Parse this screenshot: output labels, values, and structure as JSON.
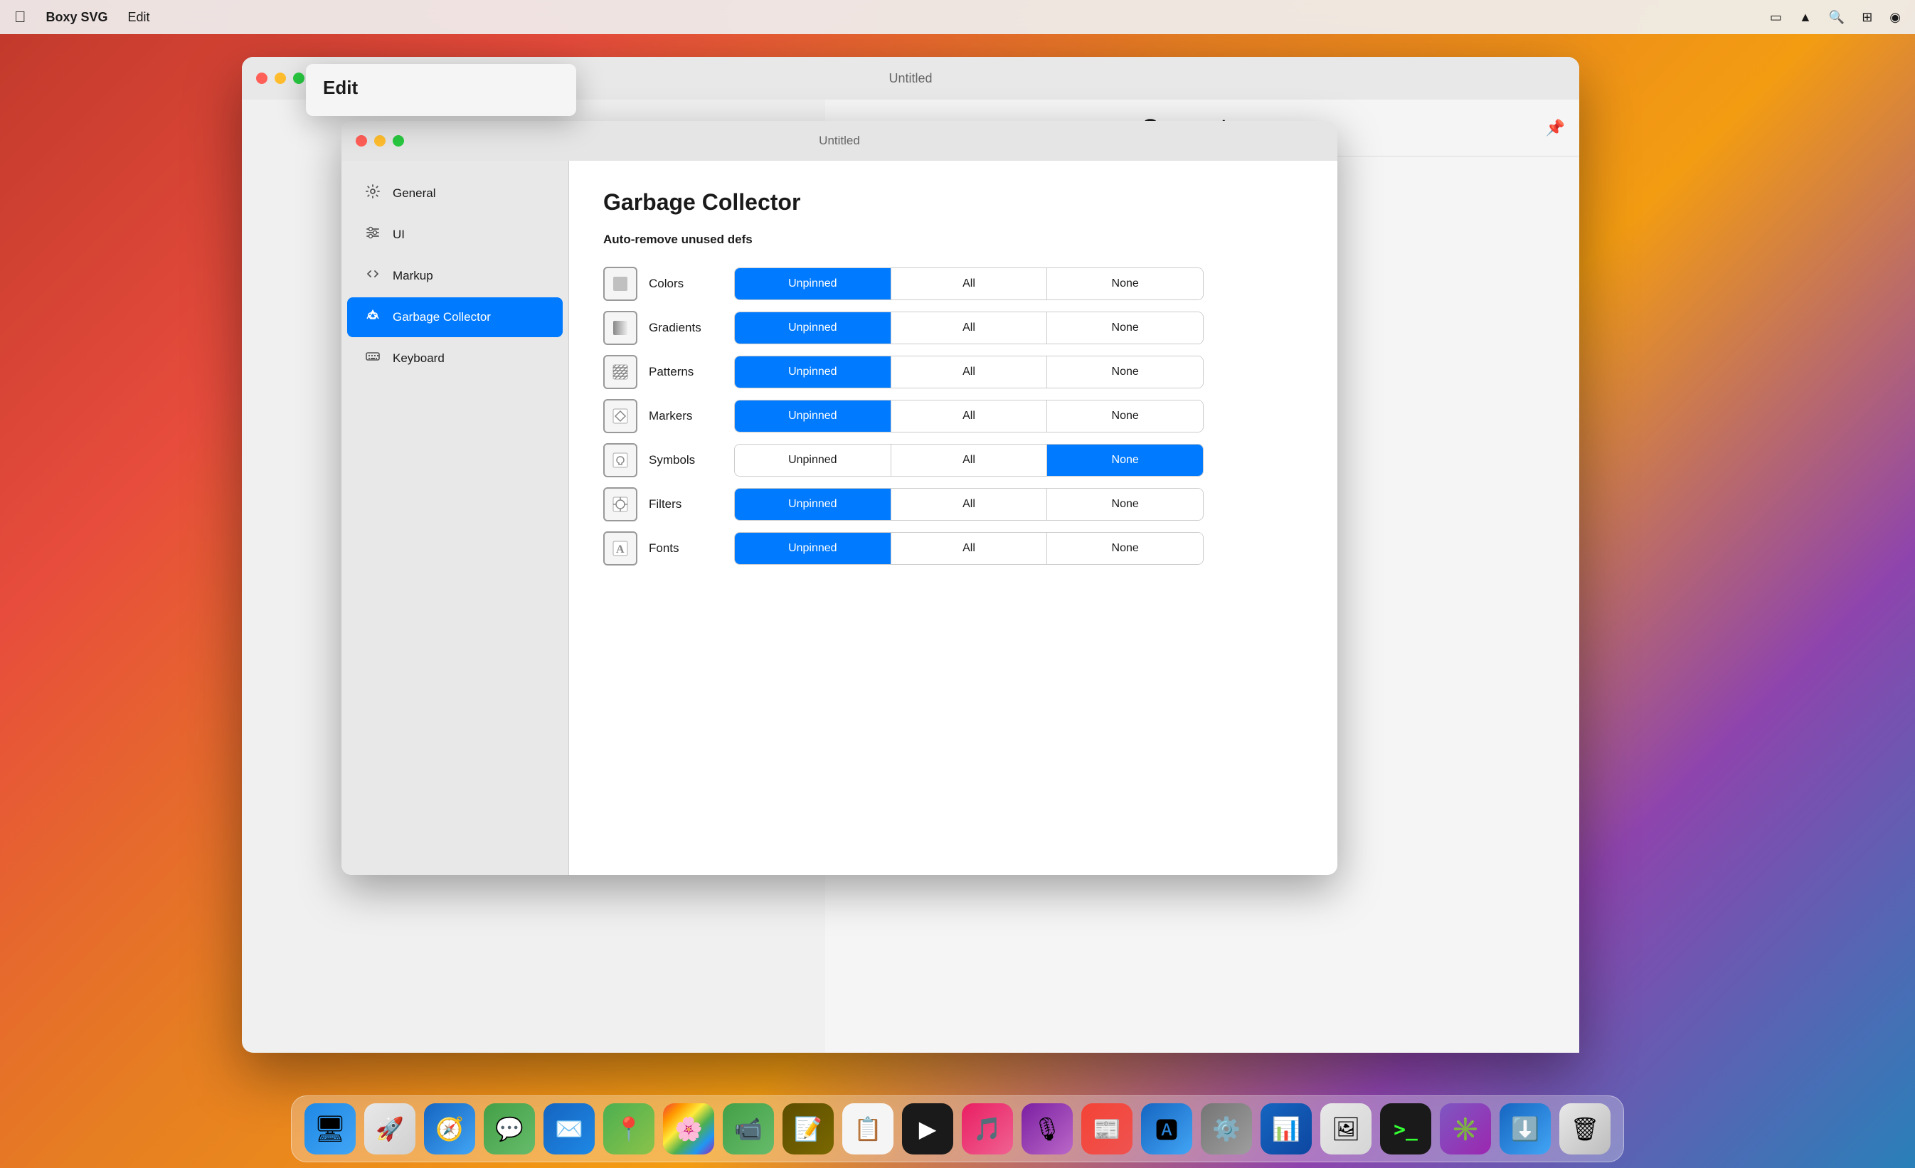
{
  "menubar": {
    "apple": "🍎",
    "items": [
      "Boxy SVG",
      "Edit"
    ],
    "right_icons": [
      "monitor",
      "wifi",
      "search",
      "control-center",
      "user"
    ]
  },
  "app_window": {
    "title": "Untitled"
  },
  "generators_panel": {
    "title": "Generators"
  },
  "edit_menu": {
    "title": "Edit"
  },
  "prefs_window": {
    "title": "Untitled",
    "sidebar_items": [
      {
        "id": "general",
        "label": "General",
        "icon": "gear"
      },
      {
        "id": "ui",
        "label": "UI",
        "icon": "sliders"
      },
      {
        "id": "markup",
        "label": "Markup",
        "icon": "markup"
      },
      {
        "id": "garbage-collector",
        "label": "Garbage Collector",
        "icon": "gc",
        "active": true
      },
      {
        "id": "keyboard",
        "label": "Keyboard",
        "icon": "keyboard"
      }
    ],
    "content": {
      "title": "Garbage Collector",
      "subtitle": "Auto-remove unused defs",
      "rows": [
        {
          "id": "colors",
          "label": "Colors",
          "icon_type": "square-fill",
          "buttons": [
            {
              "label": "Unpinned",
              "selected": true
            },
            {
              "label": "All",
              "selected": false
            },
            {
              "label": "None",
              "selected": false
            }
          ]
        },
        {
          "id": "gradients",
          "label": "Gradients",
          "icon_type": "gradient",
          "buttons": [
            {
              "label": "Unpinned",
              "selected": true
            },
            {
              "label": "All",
              "selected": false
            },
            {
              "label": "None",
              "selected": false
            }
          ]
        },
        {
          "id": "patterns",
          "label": "Patterns",
          "icon_type": "pattern",
          "buttons": [
            {
              "label": "Unpinned",
              "selected": true
            },
            {
              "label": "All",
              "selected": false
            },
            {
              "label": "None",
              "selected": false
            }
          ]
        },
        {
          "id": "markers",
          "label": "Markers",
          "icon_type": "markers",
          "buttons": [
            {
              "label": "Unpinned",
              "selected": true
            },
            {
              "label": "All",
              "selected": false
            },
            {
              "label": "None",
              "selected": false
            }
          ]
        },
        {
          "id": "symbols",
          "label": "Symbols",
          "icon_type": "symbols",
          "buttons": [
            {
              "label": "Unpinned",
              "selected": false
            },
            {
              "label": "All",
              "selected": false
            },
            {
              "label": "None",
              "selected": true
            }
          ]
        },
        {
          "id": "filters",
          "label": "Filters",
          "icon_type": "filters",
          "buttons": [
            {
              "label": "Unpinned",
              "selected": true
            },
            {
              "label": "All",
              "selected": false
            },
            {
              "label": "None",
              "selected": false
            }
          ]
        },
        {
          "id": "fonts",
          "label": "Fonts",
          "icon_type": "fonts",
          "buttons": [
            {
              "label": "Unpinned",
              "selected": true
            },
            {
              "label": "All",
              "selected": false
            },
            {
              "label": "None",
              "selected": false
            }
          ]
        }
      ]
    }
  },
  "dock": {
    "apps": [
      {
        "id": "finder",
        "label": "Finder",
        "emoji": "🔵"
      },
      {
        "id": "launchpad",
        "label": "Launchpad",
        "emoji": "🚀"
      },
      {
        "id": "safari",
        "label": "Safari",
        "emoji": "🧭"
      },
      {
        "id": "messages",
        "label": "Messages",
        "emoji": "💬"
      },
      {
        "id": "mail",
        "label": "Mail",
        "emoji": "✉️"
      },
      {
        "id": "maps",
        "label": "Maps",
        "emoji": "🗺️"
      },
      {
        "id": "photos",
        "label": "Photos",
        "emoji": "🌸"
      },
      {
        "id": "facetime",
        "label": "FaceTime",
        "emoji": "📹"
      },
      {
        "id": "notesyellow",
        "label": "Notes",
        "emoji": "📝"
      },
      {
        "id": "reminders",
        "label": "Reminders",
        "emoji": "☑️"
      },
      {
        "id": "appletv",
        "label": "Apple TV",
        "emoji": "📺"
      },
      {
        "id": "music",
        "label": "Music",
        "emoji": "🎵"
      },
      {
        "id": "podcasts",
        "label": "Podcasts",
        "emoji": "🎙️"
      },
      {
        "id": "news",
        "label": "News",
        "emoji": "📰"
      },
      {
        "id": "appstore",
        "label": "App Store",
        "emoji": "🅰️"
      },
      {
        "id": "sysprefs",
        "label": "System Preferences",
        "emoji": "⚙️"
      },
      {
        "id": "altimeter",
        "label": "AltaMeter",
        "emoji": "📊"
      },
      {
        "id": "preview",
        "label": "Preview",
        "emoji": "🖼️"
      },
      {
        "id": "terminal",
        "label": "Terminal",
        "emoji": ">"
      },
      {
        "id": "pixelmator",
        "label": "Pixelmator",
        "emoji": "✳️"
      },
      {
        "id": "downloads",
        "label": "Downloads",
        "emoji": "⬇️"
      },
      {
        "id": "trash",
        "label": "Trash",
        "emoji": "🗑️"
      }
    ]
  },
  "colors": {
    "accent": "#007aff",
    "selected_btn": "#007aff",
    "unselected_btn": "#ffffff"
  }
}
